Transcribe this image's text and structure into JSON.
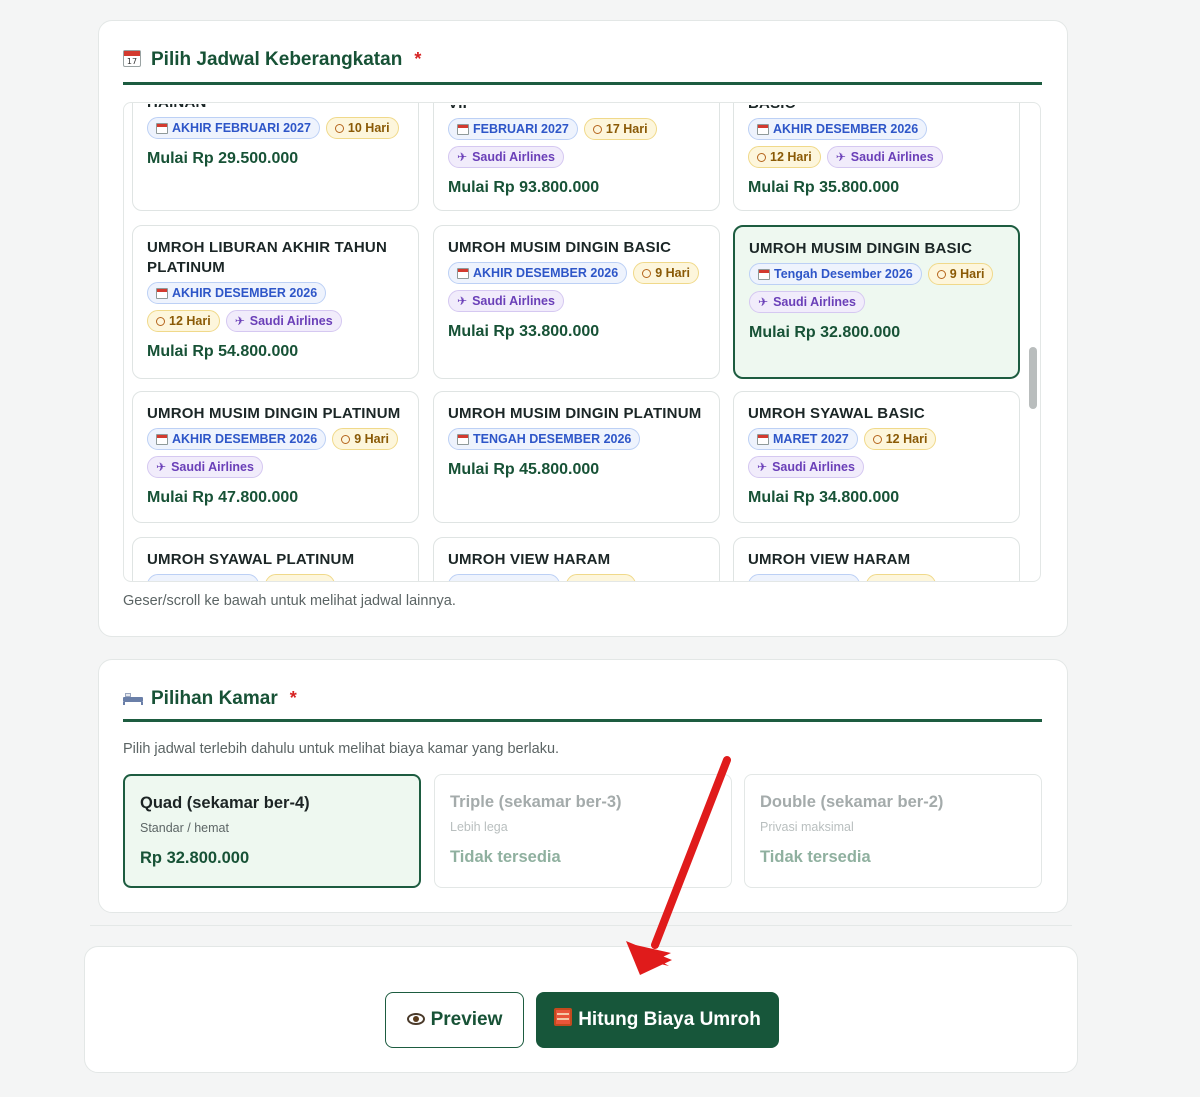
{
  "schedule": {
    "title": "Pilih Jadwal Keberangkatan",
    "required_mark": "*",
    "hint": "Geser/scroll ke bawah untuk melihat jadwal lainnya.",
    "packages": [
      {
        "name": "HAINAN",
        "date": "AKHIR FEBRUARI 2027",
        "duration": "10 Hari",
        "airline": "",
        "price": "Mulai Rp 29.500.000"
      },
      {
        "name": "VIP",
        "date": "FEBRUARI 2027",
        "duration": "17 Hari",
        "airline": "Saudi Airlines",
        "price": "Mulai Rp 93.800.000"
      },
      {
        "name": "BASIC",
        "date": "AKHIR DESEMBER 2026",
        "duration": "12 Hari",
        "airline": "Saudi Airlines",
        "price": "Mulai Rp 35.800.000"
      },
      {
        "name": "UMROH LIBURAN AKHIR TAHUN PLATINUM",
        "date": "AKHIR DESEMBER 2026",
        "duration": "12 Hari",
        "airline": "Saudi Airlines",
        "price": "Mulai Rp 54.800.000"
      },
      {
        "name": "UMROH MUSIM DINGIN BASIC",
        "date": "AKHIR DESEMBER 2026",
        "duration": "9 Hari",
        "airline": "Saudi Airlines",
        "price": "Mulai Rp 33.800.000"
      },
      {
        "name": "UMROH MUSIM DINGIN BASIC",
        "date": "Tengah Desember 2026",
        "duration": "9 Hari",
        "airline": "Saudi Airlines",
        "price": "Mulai Rp 32.800.000",
        "selected": true
      },
      {
        "name": "UMROH MUSIM DINGIN PLATINUM",
        "date": "AKHIR DESEMBER 2026",
        "duration": "9 Hari",
        "airline": "Saudi Airlines",
        "price": "Mulai Rp 47.800.000"
      },
      {
        "name": "UMROH MUSIM DINGIN PLATINUM",
        "date": "TENGAH DESEMBER 2026",
        "duration": "",
        "airline": "",
        "price": "Mulai Rp 45.800.000"
      },
      {
        "name": "UMROH SYAWAL BASIC",
        "date": "MARET 2027",
        "duration": "12 Hari",
        "airline": "Saudi Airlines",
        "price": "Mulai Rp 34.800.000"
      },
      {
        "name": "UMROH SYAWAL PLATINUM",
        "date": "",
        "duration": "",
        "airline": "",
        "price": ""
      },
      {
        "name": "UMROH VIEW HARAM",
        "date": "",
        "duration": "",
        "airline": "",
        "price": ""
      },
      {
        "name": "UMROH VIEW HARAM",
        "date": "",
        "duration": "",
        "airline": "",
        "price": ""
      }
    ]
  },
  "rooms": {
    "title": "Pilihan Kamar",
    "required_mark": "*",
    "hint": "Pilih jadwal terlebih dahulu untuk melihat biaya kamar yang berlaku.",
    "options": [
      {
        "name": "Quad (sekamar ber-4)",
        "subtitle": "Standar / hemat",
        "price": "Rp 32.800.000",
        "selected": true,
        "available": true
      },
      {
        "name": "Triple (sekamar ber-3)",
        "subtitle": "Lebih lega",
        "price": "Tidak tersedia",
        "selected": false,
        "available": false
      },
      {
        "name": "Double (sekamar ber-2)",
        "subtitle": "Privasi maksimal",
        "price": "Tidak tersedia",
        "selected": false,
        "available": false
      }
    ]
  },
  "actions": {
    "preview_label": "Preview",
    "calculate_label": "Hitung Biaya Umroh"
  },
  "colors": {
    "brand_green": "#17563a",
    "accent_red": "#e01b1b"
  }
}
